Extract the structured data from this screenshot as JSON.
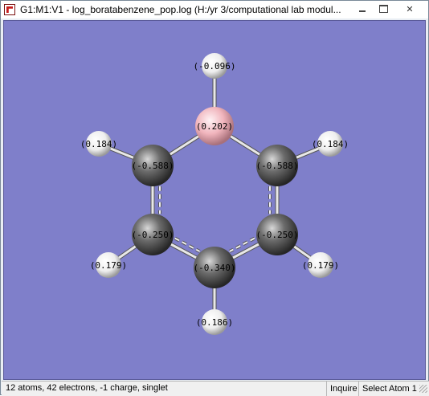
{
  "window": {
    "title": "G1:M1:V1 - log_boratabenzene_pop.log (H:/yr 3/computational lab modul...",
    "buttons": {
      "minimize": "–",
      "maximize": "□",
      "close": "✕"
    }
  },
  "molecule": {
    "colors": {
      "background": "#7f7fca",
      "boron": "#f0b4bc",
      "carbon": "#707070",
      "hydrogen": "#f2f2f2",
      "bond": "#e8e8e8"
    },
    "atoms": [
      {
        "id": "B",
        "element": "B",
        "charge": "(0.202)"
      },
      {
        "id": "C2",
        "element": "C",
        "charge": "(-0.588)"
      },
      {
        "id": "C6",
        "element": "C",
        "charge": "(-0.588)"
      },
      {
        "id": "C3",
        "element": "C",
        "charge": "(-0.250)"
      },
      {
        "id": "C5",
        "element": "C",
        "charge": "(-0.250)"
      },
      {
        "id": "C4",
        "element": "C",
        "charge": "(-0.340)"
      },
      {
        "id": "HB",
        "element": "H",
        "charge": "(-0.096)"
      },
      {
        "id": "H2",
        "element": "H",
        "charge": "(0.184)"
      },
      {
        "id": "H6",
        "element": "H",
        "charge": "(0.184)"
      },
      {
        "id": "H3",
        "element": "H",
        "charge": "(0.179)"
      },
      {
        "id": "H5",
        "element": "H",
        "charge": "(0.179)"
      },
      {
        "id": "H4",
        "element": "H",
        "charge": "(0.186)"
      }
    ]
  },
  "statusbar": {
    "info": "12 atoms, 42 electrons, -1 charge, singlet",
    "mode": "Inquire",
    "action": "Select Atom 1"
  }
}
